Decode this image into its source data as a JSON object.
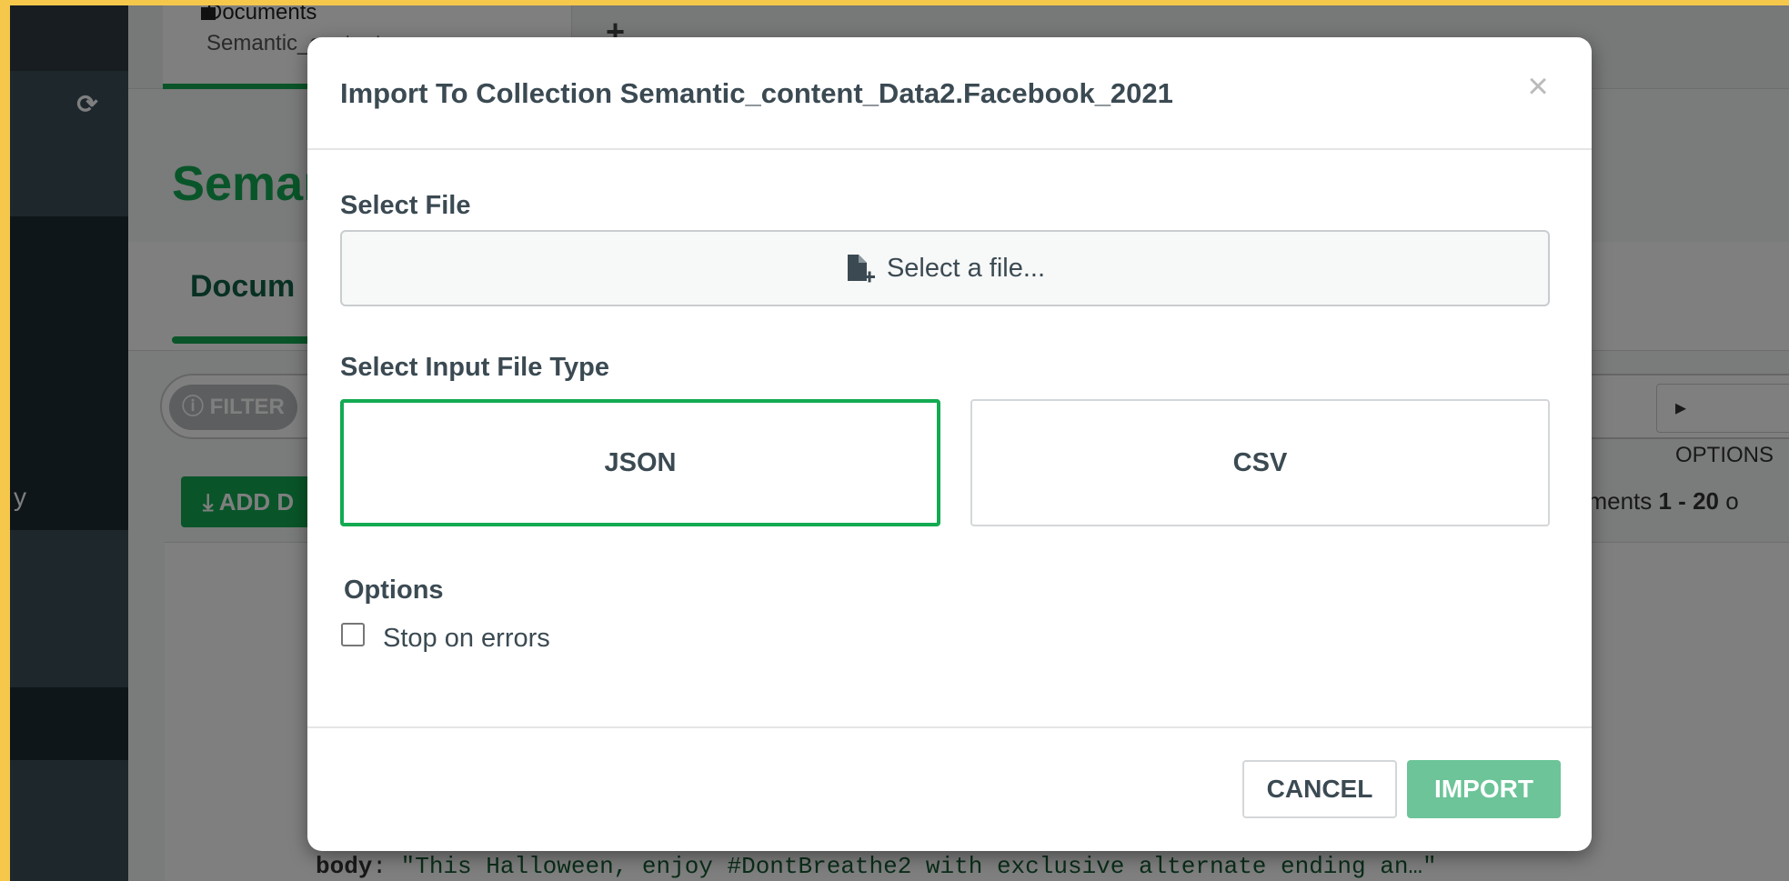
{
  "background": {
    "tab": {
      "title": "Documents",
      "subtitle": "Semantic_content..."
    },
    "tab_add_symbol": "+",
    "refresh_symbol": "⟳",
    "sidebar_fragment": "y",
    "collection_title": "Semar",
    "subtab_label": "Docum",
    "filter_label": "FILTER",
    "options_label": "OPTIONS",
    "add_data_label": "ADD D",
    "doc_count": {
      "prefix": "uments ",
      "range": "1 - 20",
      "suffix": " o"
    },
    "doc_preview": {
      "key": "body",
      "value": "\"This Halloween, enjoy #DontBreathe2 with exclusive alternate ending an…\""
    }
  },
  "modal": {
    "title": "Import To Collection Semantic_content_Data2.Facebook_2021",
    "close_symbol": "×",
    "select_file_label": "Select File",
    "select_file_button": "Select a file...",
    "file_type_label": "Select Input File Type",
    "file_types": [
      "JSON",
      "CSV"
    ],
    "selected_file_type": "JSON",
    "options_label": "Options",
    "stop_on_errors_label": "Stop on errors",
    "stop_on_errors_checked": false,
    "cancel_label": "CANCEL",
    "import_label": "IMPORT"
  },
  "colors": {
    "accent": "#13aa52",
    "import_button_disabled": "#6cc498",
    "text": "#3b4a52"
  }
}
